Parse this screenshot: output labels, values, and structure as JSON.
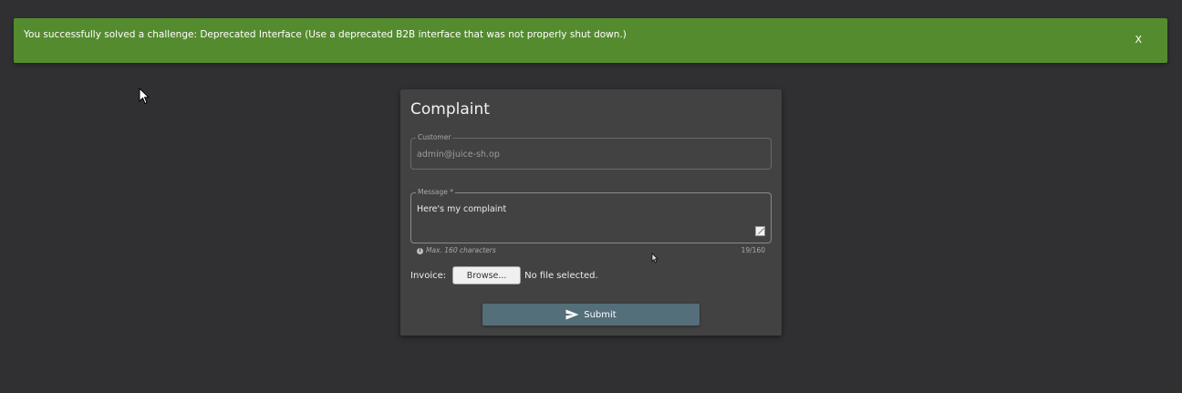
{
  "notification": {
    "message": "You successfully solved a challenge: Deprecated Interface (Use a deprecated B2B interface that was not properly shut down.)",
    "close_label": "X",
    "color": "#558b2f"
  },
  "complaint": {
    "title": "Complaint",
    "customer": {
      "label": "Customer",
      "value": "admin@juice-sh.op"
    },
    "message": {
      "label": "Message *",
      "value": "Here's my complaint",
      "hint": "Max. 160 characters",
      "hint_icon": "info-icon",
      "counter": "19/160"
    },
    "invoice": {
      "label": "Invoice:",
      "browse_label": "Browse...",
      "file_status": "No file selected."
    },
    "submit": {
      "label": "Submit",
      "icon": "send-icon",
      "color": "#546e7a"
    }
  },
  "theme": {
    "background": "#302f32",
    "card": "#424242"
  }
}
